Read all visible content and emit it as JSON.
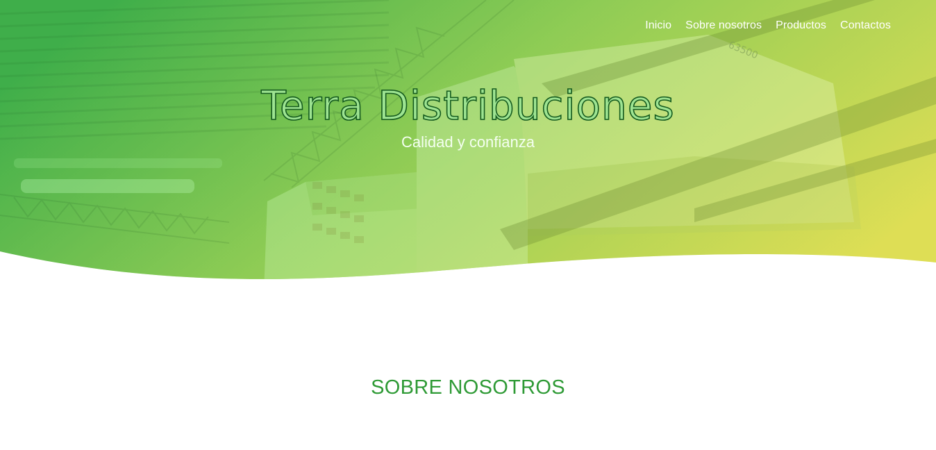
{
  "nav": {
    "items": [
      {
        "label": "Inicio"
      },
      {
        "label": "Sobre nosotros"
      },
      {
        "label": "Productos"
      },
      {
        "label": "Contactos"
      }
    ]
  },
  "hero": {
    "title": "Terra Distribuciones",
    "subtitle": "Calidad y confianza",
    "pallet_label": "63500",
    "gradient_start": "#3fae4a",
    "gradient_end": "#dede55"
  },
  "about": {
    "title": "SOBRE NOSOTROS",
    "title_color": "#2e9a35"
  }
}
